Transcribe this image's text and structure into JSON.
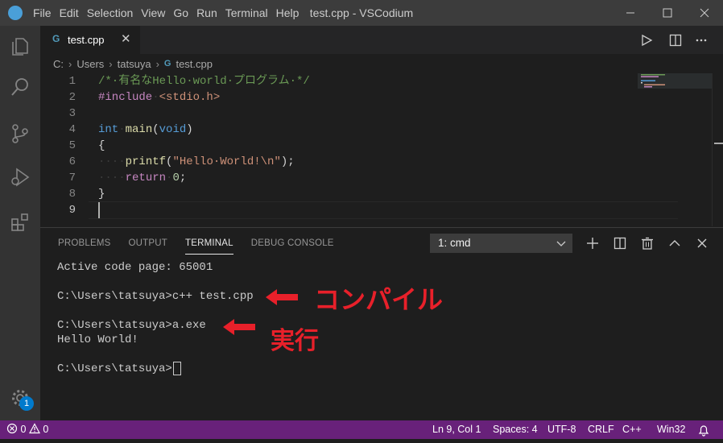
{
  "titlebar": {
    "menu": [
      "File",
      "Edit",
      "Selection",
      "View",
      "Go",
      "Run",
      "Terminal",
      "Help"
    ],
    "title": "test.cpp - VSCodium"
  },
  "tab": {
    "icon": "G",
    "label": "test.cpp"
  },
  "breadcrumb": {
    "drive": "C:",
    "items": [
      "Users",
      "tatsuya"
    ],
    "file": "test.cpp"
  },
  "editor": {
    "line_numbers": [
      "1",
      "2",
      "3",
      "4",
      "5",
      "6",
      "7",
      "8",
      "9"
    ]
  },
  "activity_badge": "1",
  "panel": {
    "tabs": [
      "PROBLEMS",
      "OUTPUT",
      "TERMINAL",
      "DEBUG CONSOLE"
    ],
    "active_tab": "TERMINAL",
    "terminal_select": "1: cmd",
    "terminal_lines": [
      "Active code page: 65001",
      "",
      "C:\\Users\\tatsuya>c++ test.cpp",
      "",
      "C:\\Users\\tatsuya>a.exe",
      "Hello World!",
      "",
      "C:\\Users\\tatsuya>"
    ]
  },
  "annotations": {
    "compile": "コンパイル",
    "run": "実行"
  },
  "statusbar": {
    "errors": "0",
    "warnings": "0",
    "position": "Ln 9, Col 1",
    "spaces": "Spaces: 4",
    "encoding": "UTF-8",
    "eol": "CRLF",
    "language": "C++",
    "platform": "Win32"
  },
  "colors": {
    "statusbar": "#68217a",
    "accent": "#007acc",
    "annotation": "#e8202a"
  }
}
